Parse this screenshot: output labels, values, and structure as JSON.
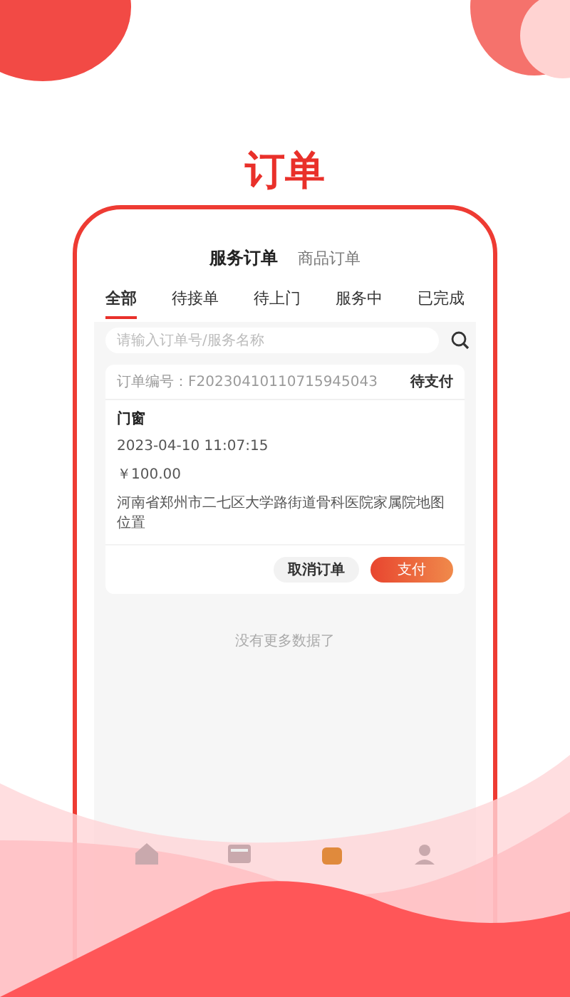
{
  "headline": "订单",
  "order_types": [
    {
      "label": "服务订单",
      "selected": true
    },
    {
      "label": "商品订单",
      "selected": false
    }
  ],
  "status_tabs": [
    {
      "label": "全部",
      "selected": true
    },
    {
      "label": "待接单",
      "selected": false
    },
    {
      "label": "待上门",
      "selected": false
    },
    {
      "label": "服务中",
      "selected": false
    },
    {
      "label": "已完成",
      "selected": false
    }
  ],
  "search": {
    "placeholder": "请输入订单号/服务名称"
  },
  "orders": [
    {
      "number_label": "订单编号：F20230410110715945043",
      "status": "待支付",
      "service": "门窗",
      "time": "2023-04-10 11:07:15",
      "price": "￥100.00",
      "address": "河南省郑州市二七区大学路街道骨科医院家属院地图位置",
      "buttons": [
        {
          "label": "取消订单",
          "kind": "secondary"
        },
        {
          "label": "支付",
          "kind": "primary"
        }
      ]
    }
  ],
  "end_note": "没有更多数据了",
  "nav_items": [
    {
      "kind": "home"
    },
    {
      "kind": "list"
    },
    {
      "kind": "shop"
    },
    {
      "kind": "profile"
    }
  ]
}
